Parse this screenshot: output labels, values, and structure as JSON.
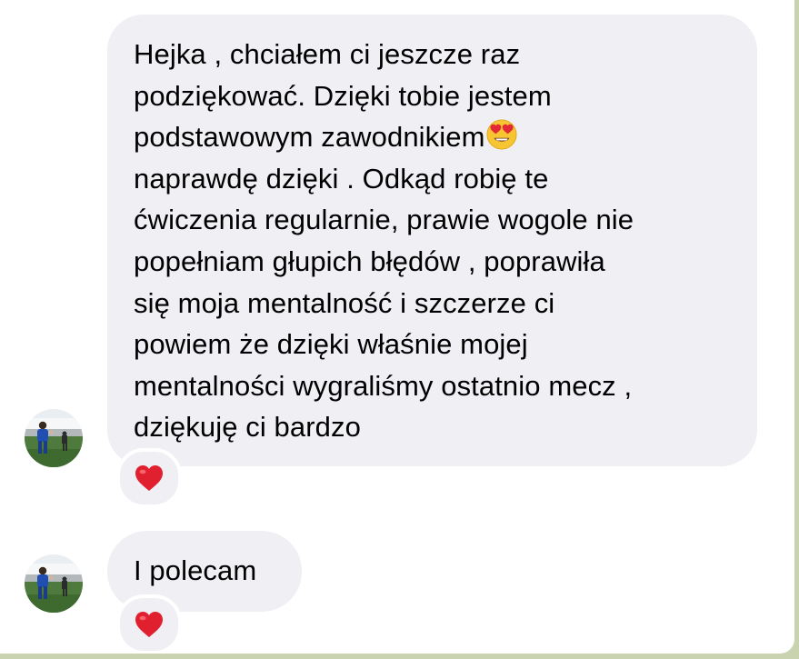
{
  "messages": [
    {
      "lines": [
        "Hejka , chciałem ci jeszcze raz",
        "podziękować. Dzięki tobie jestem",
        "podstawowym zawodnikiem",
        "naprawdę dzięki . Odkąd robię te",
        "ćwiczenia regularnie, prawie wogole nie",
        "popełniam głupich błędów , poprawiła",
        "się moja mentalność i szczerze ci",
        "powiem że dzięki właśnie mojej",
        "mentalności wygraliśmy ostatnio mecz ,",
        "dziękuję ci bardzo"
      ],
      "inline_emoji": "heart-eyes-emoji",
      "reaction": "red-heart-icon"
    },
    {
      "lines": [
        "I polecam"
      ],
      "reaction": "red-heart-icon"
    }
  ],
  "colors": {
    "bubble_bg": "#efeff4",
    "text": "#000000",
    "heart": "#e0202e",
    "page_bg": "#ffffff"
  }
}
